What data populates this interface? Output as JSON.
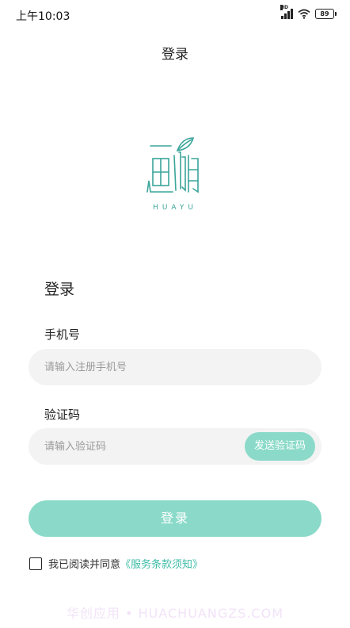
{
  "status_bar": {
    "time": "上午10:03",
    "signal_tag": "HD",
    "battery": "89"
  },
  "nav": {
    "title": "登录"
  },
  "logo": {
    "text": "HUAYU",
    "color": "#3aa59a"
  },
  "form": {
    "heading": "登录",
    "phone": {
      "label": "手机号",
      "placeholder": "请输入注册手机号",
      "value": ""
    },
    "code": {
      "label": "验证码",
      "placeholder": "请输入验证码",
      "value": "",
      "send_label": "发送验证码"
    },
    "submit_label": "登录"
  },
  "agreement": {
    "prefix": "我已阅读并同意",
    "link": "《服务条款须知》",
    "checked": false
  },
  "watermark": "华创应用 • HUACHUANGZS.COM",
  "colors": {
    "accent": "#8bdac9",
    "link": "#3fbca7"
  }
}
